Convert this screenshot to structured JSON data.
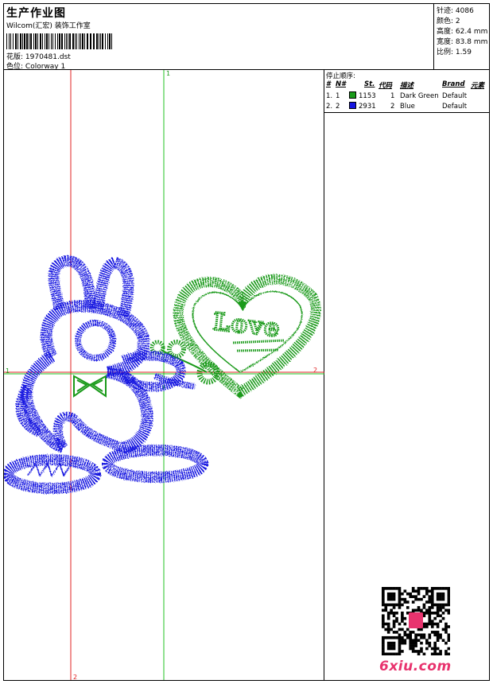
{
  "header": {
    "title": "生产作业图",
    "studio": "Wilcom(汇宏) 装饰工作室",
    "design_label": "花版:",
    "design_file": "1970481.dst",
    "colorway_label": "色位:",
    "colorway": "Colorway 1"
  },
  "stats": [
    {
      "label": "针迹:",
      "value": "4086"
    },
    {
      "label": "颜色:",
      "value": "2"
    },
    {
      "label": "高度:",
      "value": "62.4 mm"
    },
    {
      "label": "宽度:",
      "value": "83.8 mm"
    },
    {
      "label": "比例:",
      "value": "1.59"
    }
  ],
  "stop_sequence": {
    "title": "停止顺序:",
    "columns": [
      "#",
      "N#",
      "St.",
      "代码",
      "描述",
      "Brand",
      "元素"
    ],
    "rows": [
      {
        "num": "1.",
        "n": "1",
        "color": "#1a9a1a",
        "stitches": "1153",
        "code": "1",
        "desc": "Dark Green",
        "brand": "Default"
      },
      {
        "num": "2.",
        "n": "2",
        "color": "#1515e0",
        "stitches": "2931",
        "code": "2",
        "desc": "Blue",
        "brand": "Default"
      }
    ]
  },
  "axis_labels": {
    "v1_top": "1",
    "h1_left": "1",
    "h2_right": "2",
    "v2_bottom": "2"
  },
  "design_text": "Love",
  "watermark": "6xiu.com"
}
